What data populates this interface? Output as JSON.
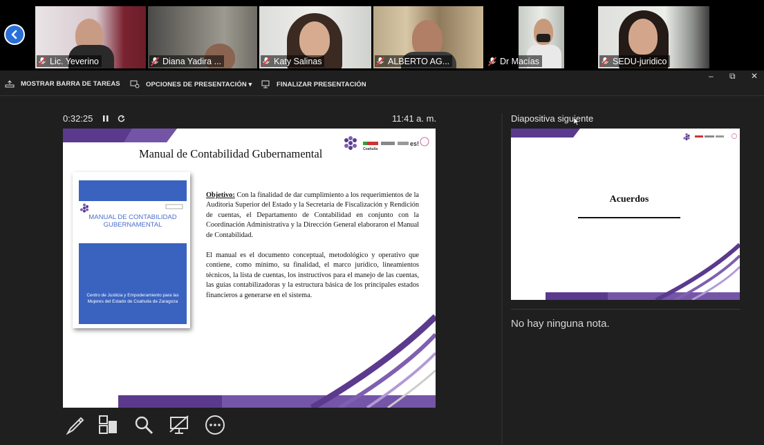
{
  "participants": [
    {
      "name": "Lic. Yeverino"
    },
    {
      "name": "Diana Yadira ..."
    },
    {
      "name": "Katy Salinas"
    },
    {
      "name": "ALBERTO AG..."
    },
    {
      "name": "Dr Macías"
    },
    {
      "name": "SEDU-juridico"
    }
  ],
  "toolbar": {
    "taskbar_label": "MOSTRAR BARRA DE TAREAS",
    "options_label": "OPCIONES DE PRESENTACIÓN ▾",
    "end_label": "FINALIZAR PRESENTACIÓN"
  },
  "window_controls": {
    "minimize": "–",
    "restore": "⧉",
    "close": "✕"
  },
  "presenter": {
    "timer": "0:32:25",
    "clock": "11:41 a. m."
  },
  "current_slide": {
    "title": "Manual de Contabilidad Gubernamental",
    "logo_text": "Coahuila",
    "book_title": "MANUAL DE CONTABILIDAD GUBERNAMENTAL",
    "book_subtitle": "Centro de Justicia y Empoderamiento para las Mujeres del Estado de Coahuila de Zaragoza",
    "objective_label": "Objetivo:",
    "paragraph1": "Con la finalidad de dar cumplimiento a los requerimientos de la Auditoria Superior del Estado y la Secretaría de Fiscalización y Rendición de cuentas, el Departamento de Contabilidad en conjunto con la Coordinación Administrativa y la Dirección General elaboraron el Manual de Contabilidad.",
    "paragraph2": "El manual es el documento conceptual, metodológico y operativo que contiene, como mínimo, su finalidad, el marco jurídico, lineamientos técnicos, la lista de cuentas, los instructivos para el manejo de las cuentas, las guías contabilizadoras y la estructura básica de los principales estados financieros a generarse en el sistema."
  },
  "next_slide": {
    "label": "Diapositiva siguiente",
    "title": "Acuerdos"
  },
  "notes": {
    "text": "No hay ninguna nota."
  },
  "colors": {
    "accent": "#5b3a8e",
    "blue": "#3a63c0",
    "background": "#1f1f1f"
  },
  "icons": [
    "chevron-left-icon",
    "pen-icon",
    "slides-grid-icon",
    "magnifier-icon",
    "screen-off-icon",
    "more-icon"
  ]
}
